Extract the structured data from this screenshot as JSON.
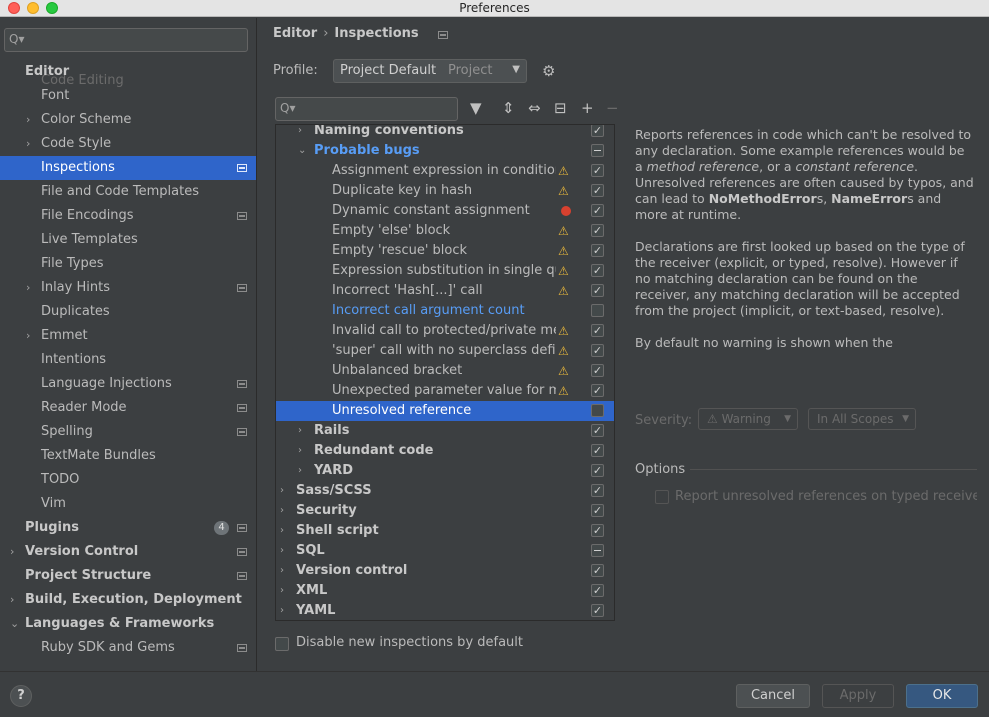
{
  "window": {
    "title": "Preferences"
  },
  "sidebar": {
    "search_placeholder": "",
    "ghost_text": "Code Editing",
    "items": [
      {
        "label": "Editor",
        "level": 0,
        "bold": true,
        "chevron": "",
        "project": false
      },
      {
        "label": "Font",
        "level": 1,
        "chevron": "",
        "project": false
      },
      {
        "label": "Color Scheme",
        "level": 1,
        "chevron": "›",
        "project": false
      },
      {
        "label": "Code Style",
        "level": 1,
        "chevron": "›",
        "project": false
      },
      {
        "label": "Inspections",
        "level": 1,
        "chevron": "",
        "project": true,
        "selected": true
      },
      {
        "label": "File and Code Templates",
        "level": 1,
        "chevron": "",
        "project": false
      },
      {
        "label": "File Encodings",
        "level": 1,
        "chevron": "",
        "project": true
      },
      {
        "label": "Live Templates",
        "level": 1,
        "chevron": "",
        "project": false
      },
      {
        "label": "File Types",
        "level": 1,
        "chevron": "",
        "project": false
      },
      {
        "label": "Inlay Hints",
        "level": 1,
        "chevron": "›",
        "project": true
      },
      {
        "label": "Duplicates",
        "level": 1,
        "chevron": "",
        "project": false
      },
      {
        "label": "Emmet",
        "level": 1,
        "chevron": "›",
        "project": false
      },
      {
        "label": "Intentions",
        "level": 1,
        "chevron": "",
        "project": false
      },
      {
        "label": "Language Injections",
        "level": 1,
        "chevron": "",
        "project": true
      },
      {
        "label": "Reader Mode",
        "level": 1,
        "chevron": "",
        "project": true
      },
      {
        "label": "Spelling",
        "level": 1,
        "chevron": "",
        "project": true
      },
      {
        "label": "TextMate Bundles",
        "level": 1,
        "chevron": "",
        "project": false
      },
      {
        "label": "TODO",
        "level": 1,
        "chevron": "",
        "project": false
      },
      {
        "label": "Vim",
        "level": 1,
        "chevron": "",
        "project": false
      },
      {
        "label": "Plugins",
        "level": 0,
        "bold": true,
        "chevron": "",
        "project": true,
        "badge": "4"
      },
      {
        "label": "Version Control",
        "level": 0,
        "bold": true,
        "chevron": "›",
        "project": true
      },
      {
        "label": "Project Structure",
        "level": 0,
        "bold": true,
        "chevron": "",
        "project": true
      },
      {
        "label": "Build, Execution, Deployment",
        "level": 0,
        "bold": true,
        "chevron": "›",
        "project": false
      },
      {
        "label": "Languages & Frameworks",
        "level": 0,
        "bold": true,
        "chevron": "⌄",
        "project": false
      },
      {
        "label": "Ruby SDK and Gems",
        "level": 1,
        "chevron": "",
        "project": true
      }
    ]
  },
  "breadcrumb": {
    "part1": "Editor",
    "separator": "›",
    "part2": "Inspections"
  },
  "profile": {
    "label": "Profile:",
    "value": "Project Default",
    "scope": "Project",
    "arrow": "▼"
  },
  "icons": {
    "search": "Q▾",
    "gear": "⚙",
    "filter": "▼",
    "expand_all": "⇕",
    "collapse_all": "⇔",
    "collapse": "⊟",
    "add": "+",
    "remove": "−"
  },
  "tree": {
    "rows": [
      {
        "label": "Naming conventions",
        "indent": 1,
        "group": true,
        "chevron": "›",
        "check": "checked"
      },
      {
        "label": "Probable bugs",
        "indent": 1,
        "group": true,
        "chevron": "⌄",
        "check": "mixed",
        "blue": true
      },
      {
        "label": "Assignment expression in conditional",
        "indent": 2,
        "warn": true,
        "check": "checked"
      },
      {
        "label": "Duplicate key in hash",
        "indent": 2,
        "warn": true,
        "check": "checked"
      },
      {
        "label": "Dynamic constant assignment",
        "indent": 2,
        "error": true,
        "check": "checked"
      },
      {
        "label": "Empty 'else' block",
        "indent": 2,
        "warn": true,
        "check": "checked"
      },
      {
        "label": "Empty 'rescue' block",
        "indent": 2,
        "warn": true,
        "check": "checked"
      },
      {
        "label": "Expression substitution in single quotes",
        "indent": 2,
        "warn": true,
        "check": "checked"
      },
      {
        "label": "Incorrect 'Hash[...]' call",
        "indent": 2,
        "warn": true,
        "check": "checked"
      },
      {
        "label": "Incorrect call argument count",
        "indent": 2,
        "link": true,
        "check": "unchecked"
      },
      {
        "label": "Invalid call to protected/private method",
        "indent": 2,
        "warn": true,
        "check": "checked"
      },
      {
        "label": "'super' call with no superclass defined",
        "indent": 2,
        "warn": true,
        "check": "checked"
      },
      {
        "label": "Unbalanced bracket",
        "indent": 2,
        "warn": true,
        "check": "checked"
      },
      {
        "label": "Unexpected parameter value for method",
        "indent": 2,
        "warn": true,
        "check": "checked"
      },
      {
        "label": "Unresolved reference",
        "indent": 2,
        "selected": true,
        "check": "unchecked"
      },
      {
        "label": "Rails",
        "indent": 1,
        "group": true,
        "chevron": "›",
        "check": "checked"
      },
      {
        "label": "Redundant code",
        "indent": 1,
        "group": true,
        "chevron": "›",
        "check": "checked"
      },
      {
        "label": "YARD",
        "indent": 1,
        "group": true,
        "chevron": "›",
        "check": "checked"
      },
      {
        "label": "Sass/SCSS",
        "indent": 0,
        "group": true,
        "chevron": "›",
        "check": "checked"
      },
      {
        "label": "Security",
        "indent": 0,
        "group": true,
        "chevron": "›",
        "check": "checked"
      },
      {
        "label": "Shell script",
        "indent": 0,
        "group": true,
        "chevron": "›",
        "check": "checked"
      },
      {
        "label": "SQL",
        "indent": 0,
        "group": true,
        "chevron": "›",
        "check": "mixed"
      },
      {
        "label": "Version control",
        "indent": 0,
        "group": true,
        "chevron": "›",
        "check": "checked"
      },
      {
        "label": "XML",
        "indent": 0,
        "group": true,
        "chevron": "›",
        "check": "checked"
      },
      {
        "label": "YAML",
        "indent": 0,
        "group": true,
        "chevron": "›",
        "check": "checked"
      }
    ],
    "disable_new_label": "Disable new inspections by default"
  },
  "description": {
    "p1": [
      {
        "t": "Reports references in code which can't be resolved to any declaration. Some example references would be a "
      },
      {
        "t": "method reference",
        "s": "i"
      },
      {
        "t": ", or a "
      },
      {
        "t": "constant reference",
        "s": "i"
      },
      {
        "t": ". Unresolved references are often caused by typos, and can lead to "
      },
      {
        "t": "NoMethodError",
        "s": "b"
      },
      {
        "t": "s, "
      },
      {
        "t": "NameError",
        "s": "b"
      },
      {
        "t": "s and more at runtime."
      }
    ],
    "p2": "Declarations are first looked up based on the type of the receiver (explicit, or typed, resolve). However if no matching declaration can be found on the receiver, any matching declaration will be accepted from the project (implicit, or text-based, resolve).",
    "p3": "By default no warning is shown when the"
  },
  "severity": {
    "label": "Severity:",
    "value": "⚠ Warning",
    "scope": "In All Scopes",
    "arrow": "▼"
  },
  "options": {
    "title": "Options",
    "checkbox_label": "Report unresolved references on typed receivers"
  },
  "buttons": {
    "help": "?",
    "cancel": "Cancel",
    "apply": "Apply",
    "ok": "OK"
  }
}
